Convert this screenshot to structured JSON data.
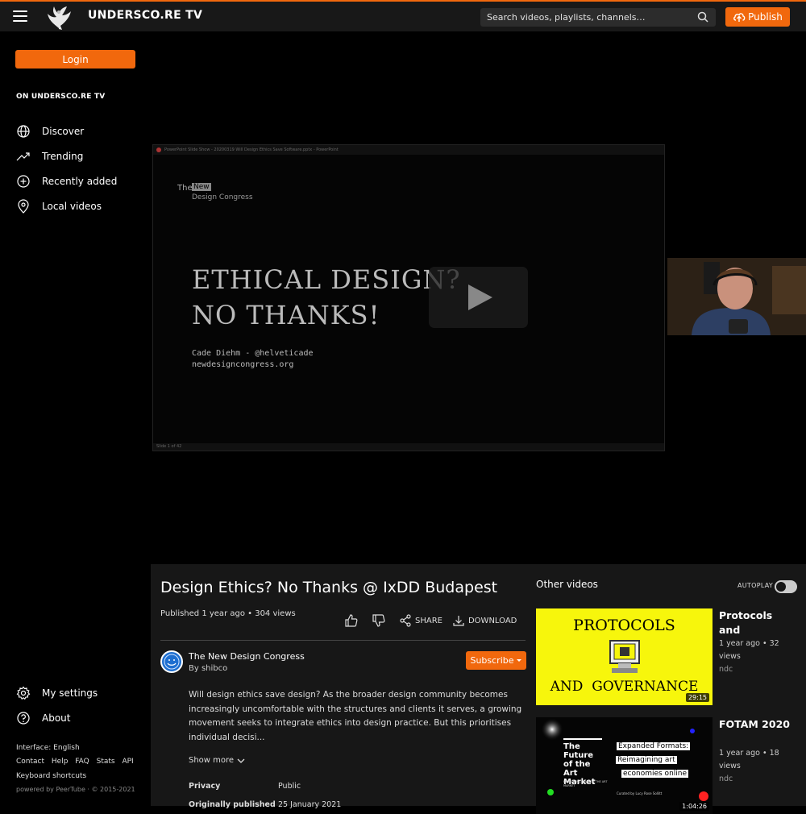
{
  "header": {
    "site_title": "UNDERSCO.RE TV",
    "search_placeholder": "Search videos, playlists, channels…",
    "publish_label": "Publish",
    "accent": "#f1680d"
  },
  "sidebar": {
    "login_label": "Login",
    "heading": "ON UNDERSCO.RE TV",
    "items": [
      {
        "label": "Discover",
        "icon": "globe-icon"
      },
      {
        "label": "Trending",
        "icon": "trending-icon"
      },
      {
        "label": "Recently added",
        "icon": "plus-circle-icon"
      },
      {
        "label": "Local videos",
        "icon": "location-pin-icon"
      }
    ],
    "bottom_items": [
      {
        "label": "My settings",
        "icon": "gear-icon"
      },
      {
        "label": "About",
        "icon": "help-circle-icon"
      }
    ],
    "interface_lang": "Interface: English",
    "links": [
      "Contact",
      "Help",
      "FAQ",
      "Stats",
      "API"
    ],
    "shortcuts": "Keyboard shortcuts",
    "powered": "powered by PeerTube · © 2015-2021"
  },
  "player": {
    "slide_window_title": "PowerPoint Slide Show - 20200319 Will Design Ethics Save Software.pptx - PowerPoint",
    "slide_brand_the": "The",
    "slide_brand_new": "New",
    "slide_brand_dc": "Design Congress",
    "slide_title_line1": "ETHICAL DESIGN?",
    "slide_title_line2": "NO THANKS!",
    "slide_author": "Cade Diehm - @helveticade",
    "slide_url": "newdesigncongress.org",
    "slide_status": "Slide 1 of 42"
  },
  "video": {
    "title": "Design Ethics? No Thanks @ IxDD Budapest",
    "meta": "Published 1 year ago • 304 views",
    "share_label": "SHARE",
    "download_label": "DOWNLOAD",
    "channel_name": "The New Design Congress",
    "channel_by": "By shibco",
    "subscribe_label": "Subscribe",
    "description": "Will design ethics save design? As the broader design community becomes increasingly uncomfortable with the structures and clients it serves, a growing movement seeks to integrate ethics into design practice. But this prioritises individual decisi...",
    "show_more": "Show more",
    "privacy_label": "Privacy",
    "privacy_value": "Public",
    "published_label": "Originally published",
    "published_value": "25 January 2021"
  },
  "other": {
    "heading": "Other videos",
    "autoplay_label": "AUTOPLAY",
    "videos": [
      {
        "title": "Protocols and",
        "meta": "1 year ago • 32 views",
        "channel": "ndc",
        "duration": "29:15",
        "thumb_line1": "PROTOCOLS",
        "thumb_line2": "AND  GOVERNANCE"
      },
      {
        "title": "FOTAM 2020",
        "meta": "1 year ago • 18 views",
        "channel": "ndc",
        "duration": "1:04:26",
        "thumb_text1": "The Future of the Art Market",
        "thumb_sub": "REDEFINING VALUE IN THE ART MARKET",
        "thumb_label1": "Expanded Formats:",
        "thumb_label2": "Reimagining art",
        "thumb_label3": "economies online",
        "thumb_credit": "Curated by Lucy Rose Sollitt"
      }
    ]
  }
}
